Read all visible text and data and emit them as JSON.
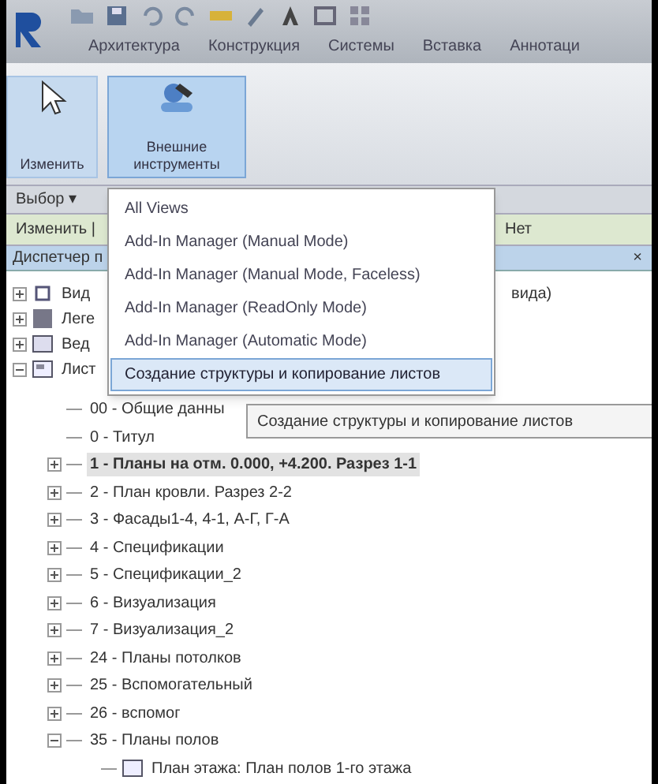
{
  "ribbon_tabs": [
    {
      "label": "Архитектура",
      "selected": false
    },
    {
      "label": "Конструкция",
      "selected": false
    },
    {
      "label": "Системы",
      "selected": false
    },
    {
      "label": "Вставка",
      "selected": false
    },
    {
      "label": "Аннотаци",
      "selected": false
    }
  ],
  "ribbon_buttons": [
    {
      "kind": "modify",
      "label": "Изменить",
      "selected": false
    },
    {
      "kind": "external",
      "label": "Внешние инструменты",
      "selected": true
    }
  ],
  "panel_label": "Выбор ▾",
  "options_bar": {
    "label": "Изменить |",
    "value": "Нет"
  },
  "browser": {
    "title": "Диспетчер п",
    "close": "×"
  },
  "tree": [
    {
      "kind": "views",
      "label": "Вид",
      "tail": "вида)",
      "expanded": false
    },
    {
      "kind": "legend",
      "label": "Леге",
      "expanded": false
    },
    {
      "kind": "schedule",
      "label": "Вед",
      "expanded": false
    },
    {
      "kind": "sheets",
      "label": "Лист",
      "expanded": true,
      "children": [
        {
          "label": "00 - Общие данны",
          "selected": false,
          "bold": false
        },
        {
          "label": "0 - Титул",
          "selected": false,
          "bold": false
        },
        {
          "label": "1 - Планы на отм. 0.000, +4.200. Разрез 1-1",
          "expanded": false,
          "selected": true,
          "bold": true
        },
        {
          "label": "2 - План кровли. Разрез 2-2",
          "expanded": false,
          "selected": false,
          "bold": false
        },
        {
          "label": "3 - Фасады1-4, 4-1, А-Г, Г-А",
          "expanded": false,
          "selected": false,
          "bold": false
        },
        {
          "label": "4 - Спецификации",
          "expanded": false,
          "selected": false,
          "bold": false
        },
        {
          "label": "5 - Спецификации_2",
          "expanded": false,
          "selected": false,
          "bold": false
        },
        {
          "label": "6 - Визуализация",
          "expanded": false,
          "selected": false,
          "bold": false
        },
        {
          "label": "7 - Визуализация_2",
          "expanded": false,
          "selected": false,
          "bold": false
        },
        {
          "label": "24 - Планы потолков",
          "expanded": false,
          "selected": false,
          "bold": false
        },
        {
          "label": "25 - Вспомогательный",
          "expanded": false,
          "selected": false,
          "bold": false
        },
        {
          "label": "26 - вспомог",
          "expanded": false,
          "selected": false,
          "bold": false
        },
        {
          "label": "35 - Планы полов",
          "expanded": true,
          "selected": false,
          "bold": false,
          "children": [
            {
              "label": "План этажа: План полов 1-го этажа",
              "selected": false,
              "bold": false
            }
          ]
        }
      ]
    }
  ],
  "dropdown_menu": [
    {
      "label": "All Views",
      "selected": false
    },
    {
      "label": "Add-In Manager (Manual Mode)",
      "selected": false
    },
    {
      "label": "Add-In Manager (Manual Mode, Faceless)",
      "selected": false
    },
    {
      "label": "Add-In Manager (ReadOnly Mode)",
      "selected": false
    },
    {
      "label": "Add-In Manager (Automatic Mode)",
      "selected": false
    },
    {
      "label": "Создание структуры и копирование листов",
      "selected": true
    }
  ],
  "tooltip": "Создание структуры и копирование листов"
}
